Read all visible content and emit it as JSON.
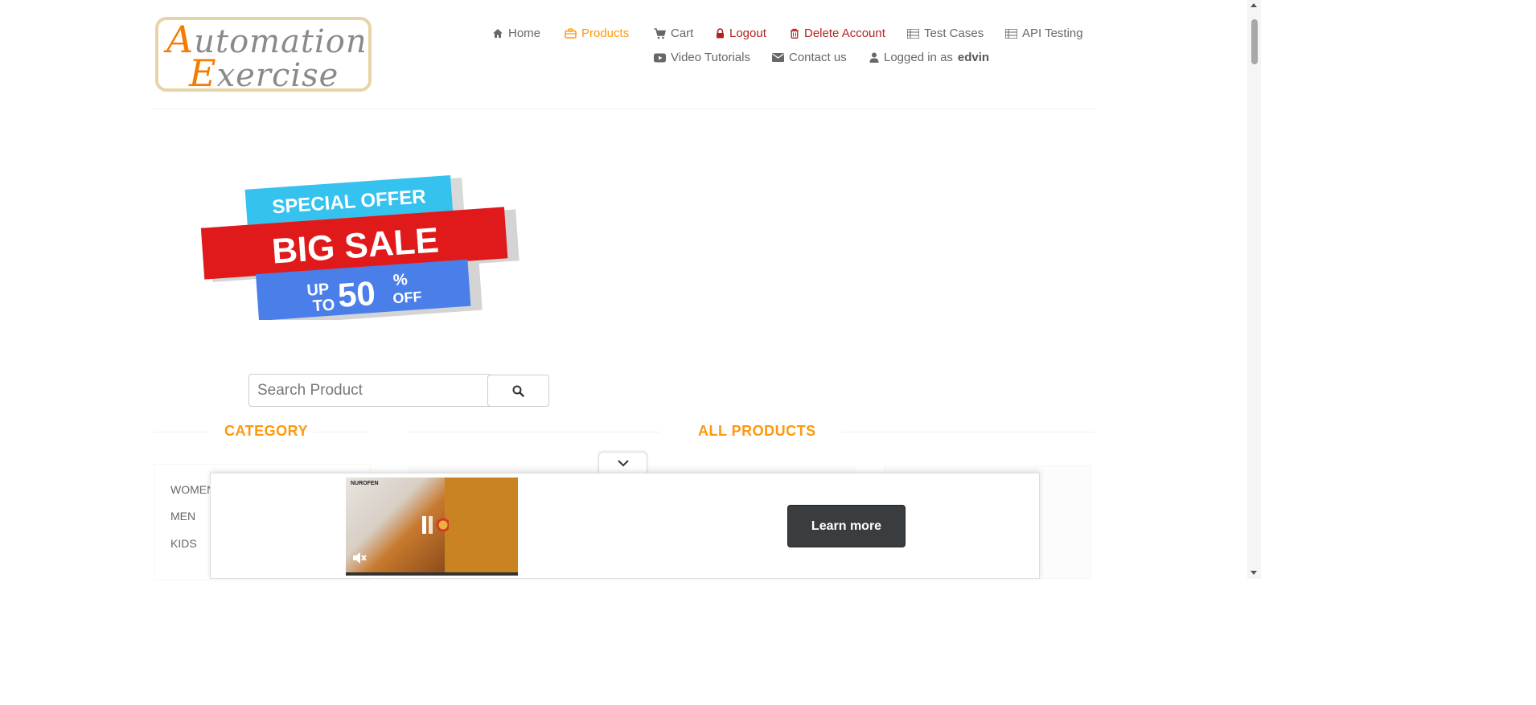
{
  "logo": {
    "line1_first": "A",
    "line1_rest": "utomation",
    "line2_first": "E",
    "line2_rest": "xercise"
  },
  "nav": {
    "home": "Home",
    "products": "Products",
    "cart": "Cart",
    "logout": "Logout",
    "delete_account": "Delete Account",
    "test_cases": "Test Cases",
    "api_testing": "API Testing",
    "video_tutorials": "Video Tutorials",
    "contact_us": "Contact us",
    "logged_in_prefix": "Logged in as",
    "username": "edvin"
  },
  "banner": {
    "line1": "SPECIAL OFFER",
    "line2": "BIG SALE",
    "up": "UP",
    "to": "TO",
    "amount": "50",
    "percent": "%",
    "off": "OFF"
  },
  "search": {
    "placeholder": "Search Product",
    "value": ""
  },
  "sections": {
    "category": "CATEGORY",
    "all_products": "ALL PRODUCTS"
  },
  "categories": [
    "WOMEN",
    "MEN",
    "KIDS"
  ],
  "ad": {
    "brand": "NUROFEN",
    "button": "Learn more"
  },
  "colors": {
    "accent": "#fe980f",
    "danger": "#b22222",
    "text": "#696763",
    "ad_button": "#3a3d40"
  },
  "icons": {
    "home": "home-icon",
    "products": "briefcase-icon",
    "cart": "cart-icon",
    "logout": "lock-icon",
    "delete": "trash-icon",
    "list": "list-icon",
    "video": "youtube-play-icon",
    "mail": "envelope-icon",
    "user": "user-icon",
    "search": "search-icon",
    "collapse": "chevron-down-icon",
    "mute": "mute-icon"
  }
}
